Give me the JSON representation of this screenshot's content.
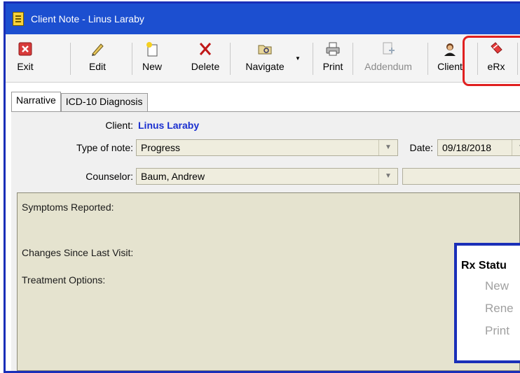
{
  "window": {
    "title": "Client Note - Linus Laraby"
  },
  "toolbar": {
    "buttons": [
      {
        "label": "Exit",
        "icon": "exit-icon"
      },
      {
        "label": "Edit",
        "icon": "pencil-icon"
      },
      {
        "label": "New",
        "icon": "new-document-icon"
      },
      {
        "label": "Delete",
        "icon": "delete-x-icon"
      },
      {
        "label": "Navigate",
        "icon": "navigate-folder-icon"
      },
      {
        "label": "Print",
        "icon": "printer-icon"
      },
      {
        "label": "Addendum",
        "icon": "addendum-icon",
        "disabled": true
      },
      {
        "label": "Client",
        "icon": "client-person-icon"
      },
      {
        "label": "eRx",
        "icon": "erx-pill-icon"
      }
    ]
  },
  "tabs": [
    {
      "label": "Narrative",
      "active": true
    },
    {
      "label": "ICD-10 Diagnosis",
      "active": false
    }
  ],
  "form": {
    "client_label": "Client:",
    "client_value": "Linus Laraby",
    "type_label": "Type of note:",
    "type_value": "Progress",
    "date_label": "Date:",
    "date_value": "09/18/2018",
    "counselor_label": "Counselor:",
    "counselor_value": "Baum, Andrew",
    "second_counselor_value": ""
  },
  "notes": {
    "symptoms": "Symptoms Reported:",
    "changes": "Changes Since Last Visit:",
    "treatment": "Treatment Options:"
  },
  "rx_status": {
    "title": "Rx Statu",
    "items": [
      "New",
      "Rene",
      "Print"
    ]
  },
  "colors": {
    "title_bar": "#1c4fd0",
    "highlight_red": "#e02020",
    "callout_blue": "#1a2fb8",
    "client_name": "#1a2fd0"
  }
}
